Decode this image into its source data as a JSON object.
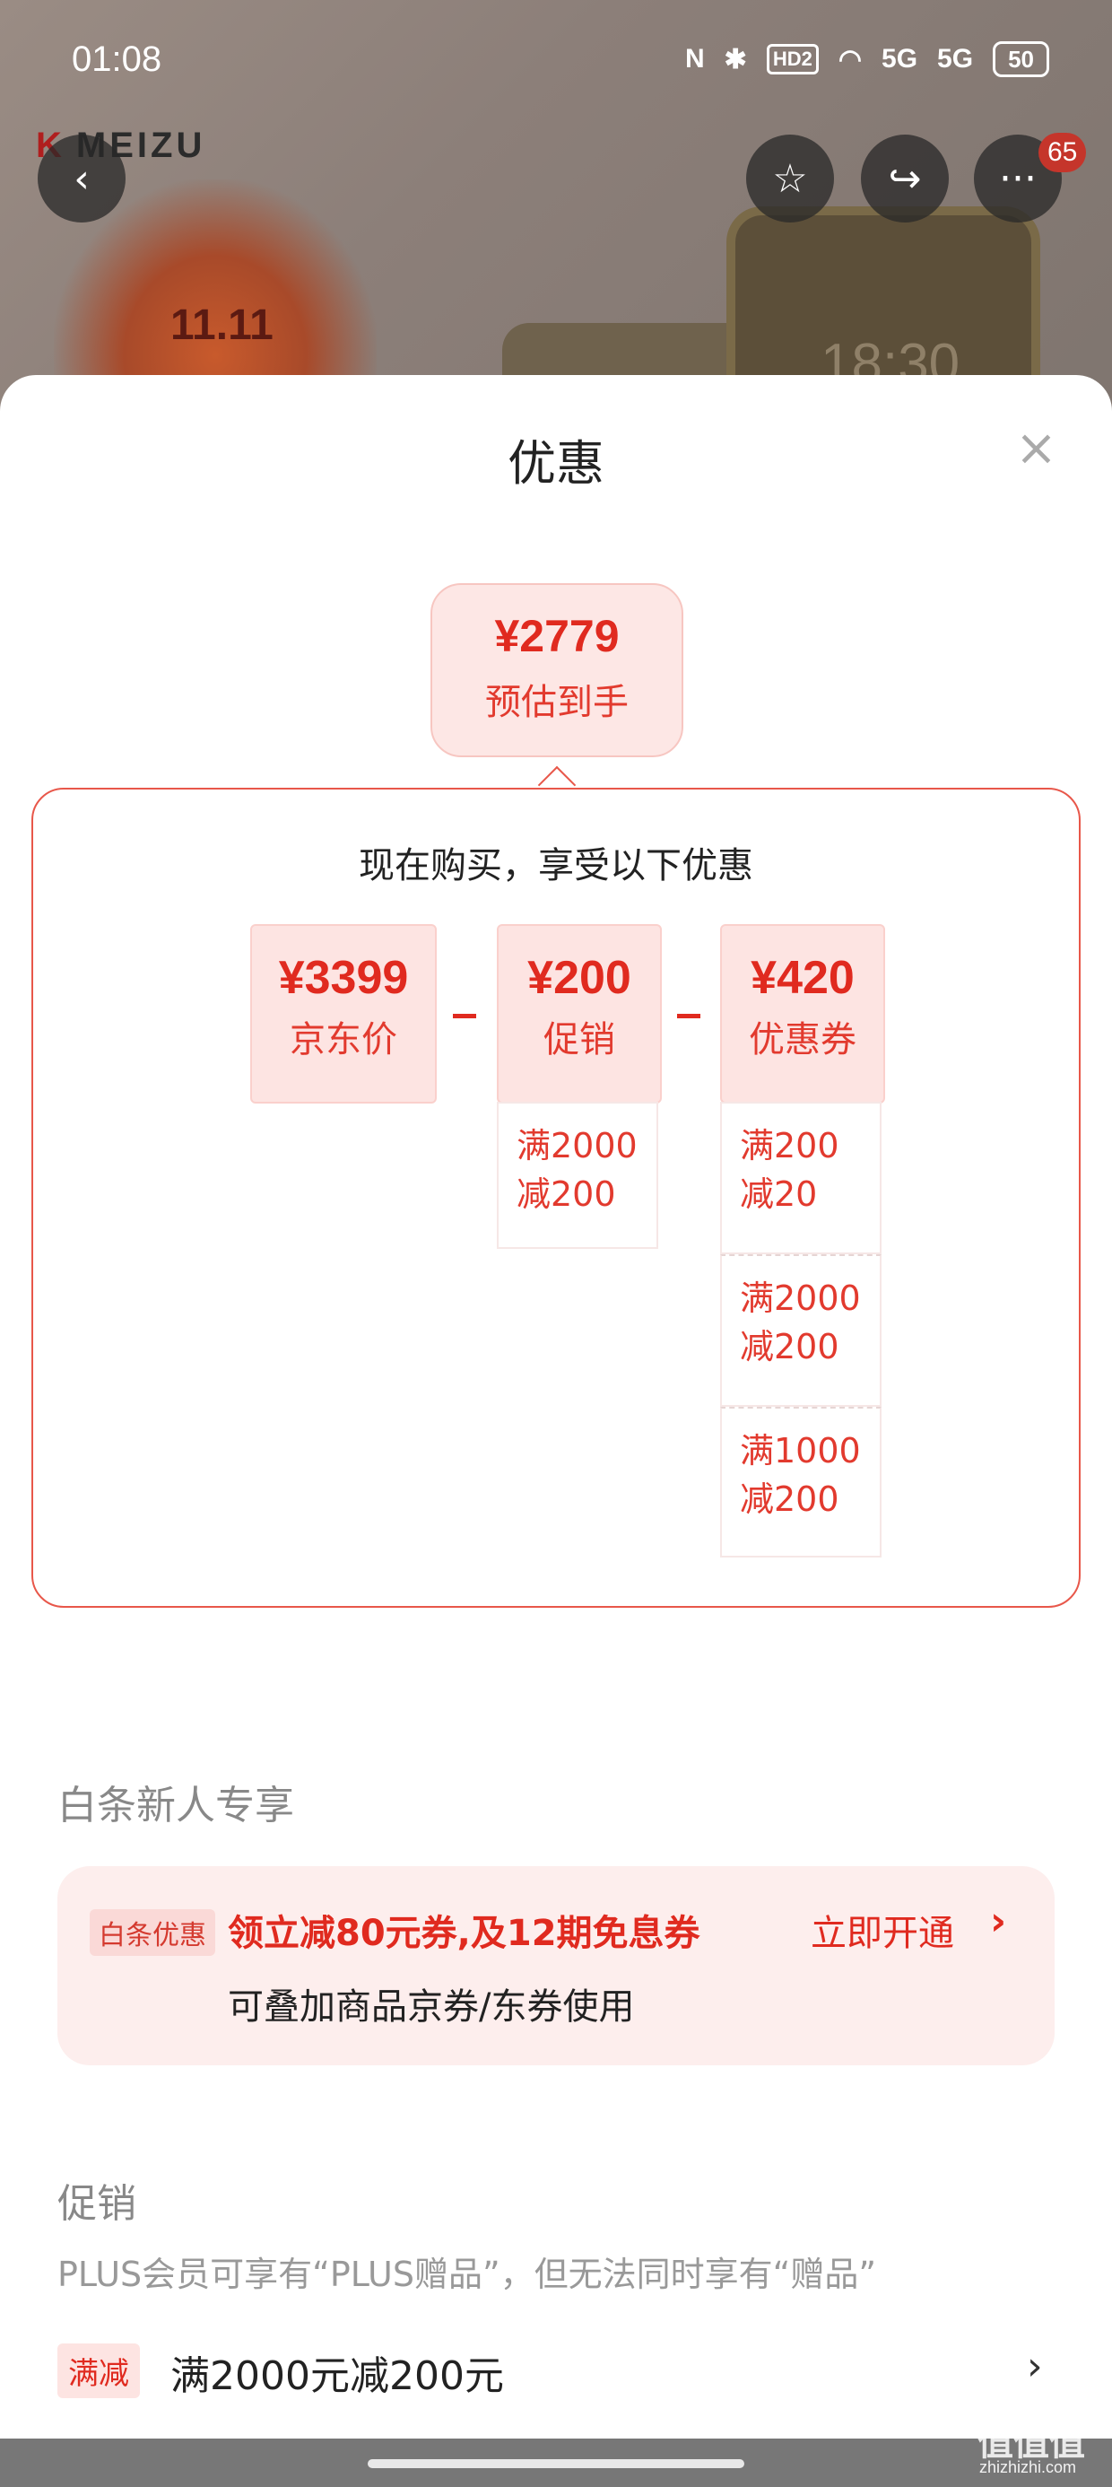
{
  "status_bar": {
    "time": "01:08",
    "nfc": "N",
    "bluetooth": "✱",
    "hd": "HD2",
    "wifi": "◠",
    "net1": "5G",
    "net2": "5G",
    "battery": "50"
  },
  "background": {
    "brand": "MEIZU",
    "event": "11.11",
    "phone_time": "18:30"
  },
  "top_actions": {
    "back_icon": "‹",
    "favorite_icon": "☆",
    "share_icon": "↪",
    "more_icon": "···",
    "more_badge": "65"
  },
  "sheet": {
    "title": "优惠",
    "close_icon": "×",
    "estimate": {
      "price": "¥2779",
      "label": "预估到手"
    },
    "panel_heading": "现在购买，享受以下优惠",
    "tiles": [
      {
        "value": "¥3399",
        "label": "京东价"
      },
      {
        "value": "¥200",
        "label": "促销"
      },
      {
        "value": "¥420",
        "label": "优惠券"
      }
    ],
    "promo_items": [
      "满2000\n减200"
    ],
    "coupon_items": [
      "满200\n减20",
      "满2000\n减200",
      "满1000\n减200"
    ]
  },
  "baitiao": {
    "section_title": "白条新人专享",
    "tag": "白条优惠",
    "main": "领立减80元券,及12期免息券",
    "sub": "可叠加商品京券/东券使用",
    "action": "立即开通",
    "chevron": "›"
  },
  "promotion": {
    "section_title": "促销",
    "note": "PLUS会员可享有“PLUS赠品”，但无法同时享有“赠品”",
    "tag": "满减",
    "text": "满2000元减200元",
    "chevron": "›"
  },
  "watermark": {
    "main": "值值值",
    "sub": "zhizhizhi.com"
  }
}
